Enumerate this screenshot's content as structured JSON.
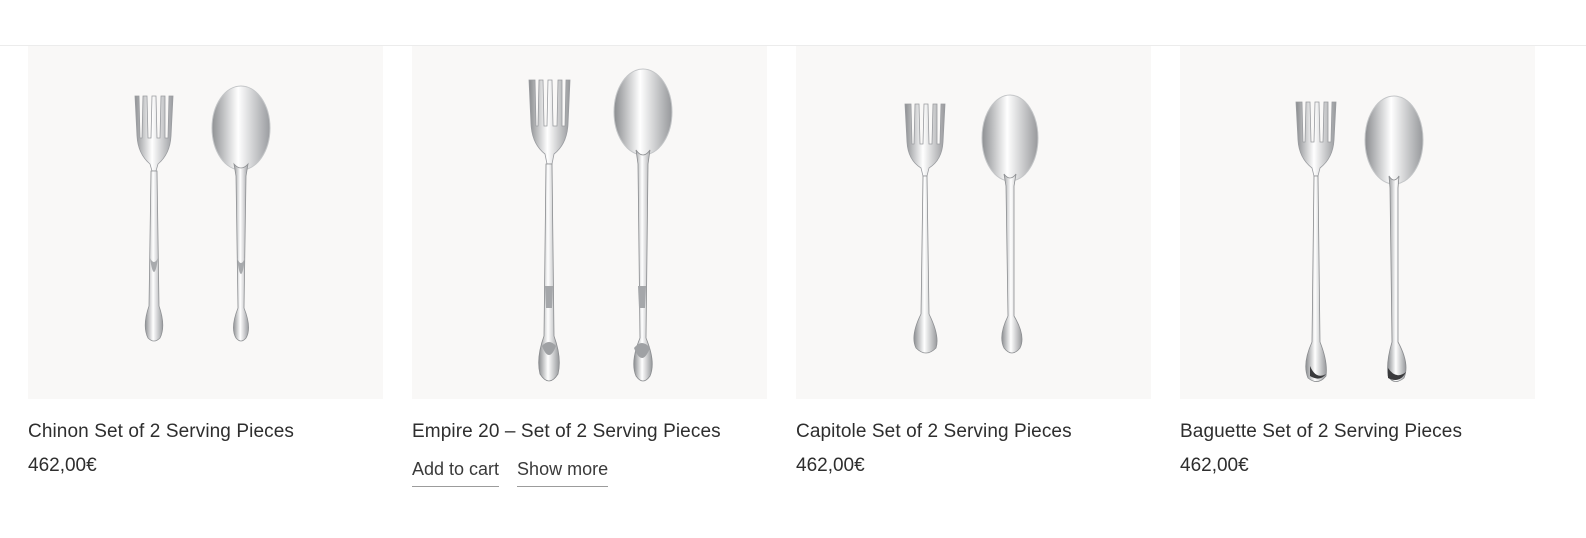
{
  "colors": {
    "image_background": "#f9f8f7",
    "text": "#2e2e2e",
    "divider": "#ececec"
  },
  "products": [
    {
      "title": "Chinon Set of 2 Serving  Pieces",
      "price": "462,00€",
      "image": "chinon-fork-and-spoon"
    },
    {
      "title": "Empire 20 – Set of 2 Serving  Pieces",
      "price": "",
      "add_to_cart": "Add to cart",
      "show_more": "Show more",
      "image": "empire-fork-and-spoon"
    },
    {
      "title": "Capitole Set of 2 Serving  Pieces",
      "price": "462,00€",
      "image": "capitole-fork-and-spoon"
    },
    {
      "title": "Baguette Set of 2 Serving  Pieces",
      "price": "462,00€",
      "image": "baguette-fork-and-spoon"
    }
  ]
}
